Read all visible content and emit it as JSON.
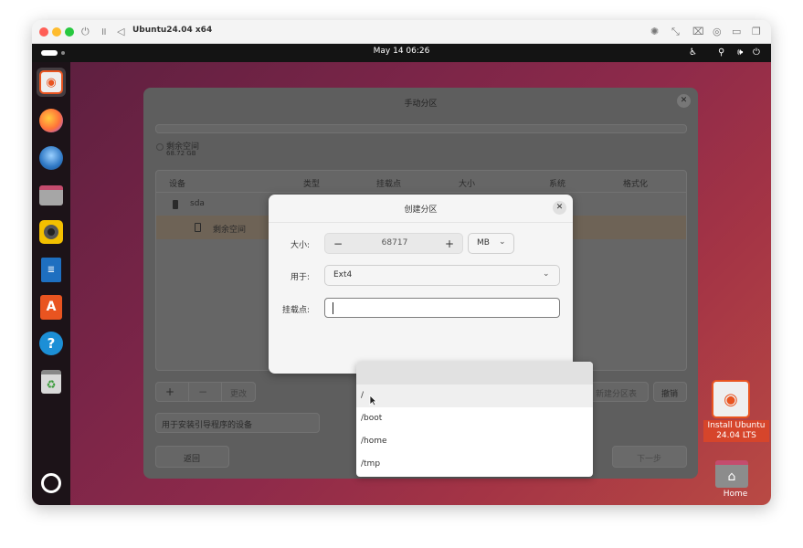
{
  "vm_window": {
    "title": "Ubuntu24.04 x64"
  },
  "topbar": {
    "clock": "May 14  06:26"
  },
  "dock": {
    "items": [
      {
        "name": "ubuntu-installer",
        "icon": "installer-icon",
        "color": "#e95420"
      },
      {
        "name": "firefox",
        "icon": "firefox-icon",
        "color": "#ff7139"
      },
      {
        "name": "thunderbird",
        "icon": "thunderbird-icon",
        "color": "#2f78c4"
      },
      {
        "name": "files",
        "icon": "folder-icon",
        "color": "#a6a6a6"
      },
      {
        "name": "rhythmbox",
        "icon": "speaker-icon",
        "color": "#f3c000"
      },
      {
        "name": "libreoffice-writer",
        "icon": "writer-icon",
        "color": "#1e6fc0"
      },
      {
        "name": "app-center",
        "icon": "app-center-icon",
        "color": "#e95420"
      },
      {
        "name": "help",
        "icon": "help-icon",
        "color": "#1c8fd6"
      },
      {
        "name": "trash",
        "icon": "trash-icon",
        "color": "#888888"
      }
    ],
    "apps_grid_icon": "ubuntu-logo-icon"
  },
  "installer": {
    "title": "手动分区",
    "free_space_label": "剩余空间",
    "free_space_size": "68.72 GB",
    "table_headers": [
      "设备",
      "类型",
      "挂载点",
      "大小",
      "系统",
      "格式化"
    ],
    "rows": [
      {
        "device": "sda"
      },
      {
        "device": "剩余空间"
      }
    ],
    "buttons": {
      "add": "+",
      "remove": "−",
      "change": "更改",
      "new_table": "新建分区表",
      "revert": "撤销",
      "back": "返回",
      "next": "下一步"
    },
    "bootloader_label": "用于安装引导程序的设备",
    "progress": {
      "total_steps": 11,
      "current_step": 7
    }
  },
  "create_partition": {
    "title": "创建分区",
    "size_label": "大小:",
    "size_value": "68717",
    "size_unit": "MB",
    "use_as_label": "用于:",
    "use_as_value": "Ext4",
    "mount_label": "挂载点:",
    "mount_value": ""
  },
  "mount_options": [
    "",
    "/",
    "/boot",
    "/home",
    "/tmp"
  ],
  "desktop": {
    "install_icon_label": "Install Ubuntu 24.04 LTS",
    "home_icon_label": "Home"
  },
  "colors": {
    "accent": "#e95420",
    "traffic_close": "#ff5f57",
    "traffic_min": "#febc2e",
    "traffic_max": "#28c840"
  }
}
